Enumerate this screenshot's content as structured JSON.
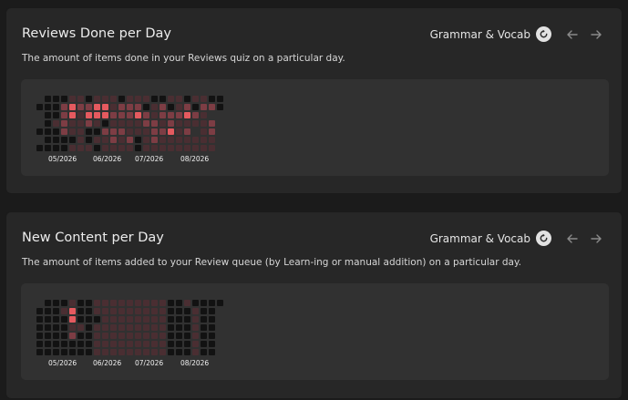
{
  "panels": [
    {
      "title": "Reviews Done per Day",
      "description": "The amount of items done in your Reviews quiz on a particular day.",
      "deck_label": "Grammar & Vocab",
      "months": [
        "05/2026",
        "06/2026",
        "07/2026",
        "08/2026"
      ],
      "heatmap": [
        "01112212221222112212211",
        "11134334423331231231331",
        "01134244433343233343200",
        "01232232122223323222230",
        "11132211333222334230230",
        "01111212232312322222220",
        "11112221222212222222220"
      ]
    },
    {
      "title": "New Content per Day",
      "description": "The amount of items added to your Review queue (by Learn-ing or manual addition) on a particular day.",
      "deck_label": "Grammar & Vocab",
      "months": [
        "05/2026",
        "06/2026",
        "07/2026",
        "08/2026"
      ],
      "heatmap": [
        "01112112222222221121111",
        "11124112222222221112110",
        "11114111222222221112110",
        "11112212222222221112110",
        "11113112222222221112110",
        "11111112222222221112110",
        "11111112222222221112110"
      ]
    }
  ],
  "colors": {
    "level_0": "#1b1b1b",
    "level_1": "#121212",
    "level_2": "#4a2e32",
    "level_3": "#7d3d44",
    "level_4": "#e55a5f",
    "accent": "#e55a5f"
  },
  "icons": {
    "refresh": "refresh-icon",
    "prev": "chevron-left-icon",
    "next": "chevron-right-icon"
  }
}
